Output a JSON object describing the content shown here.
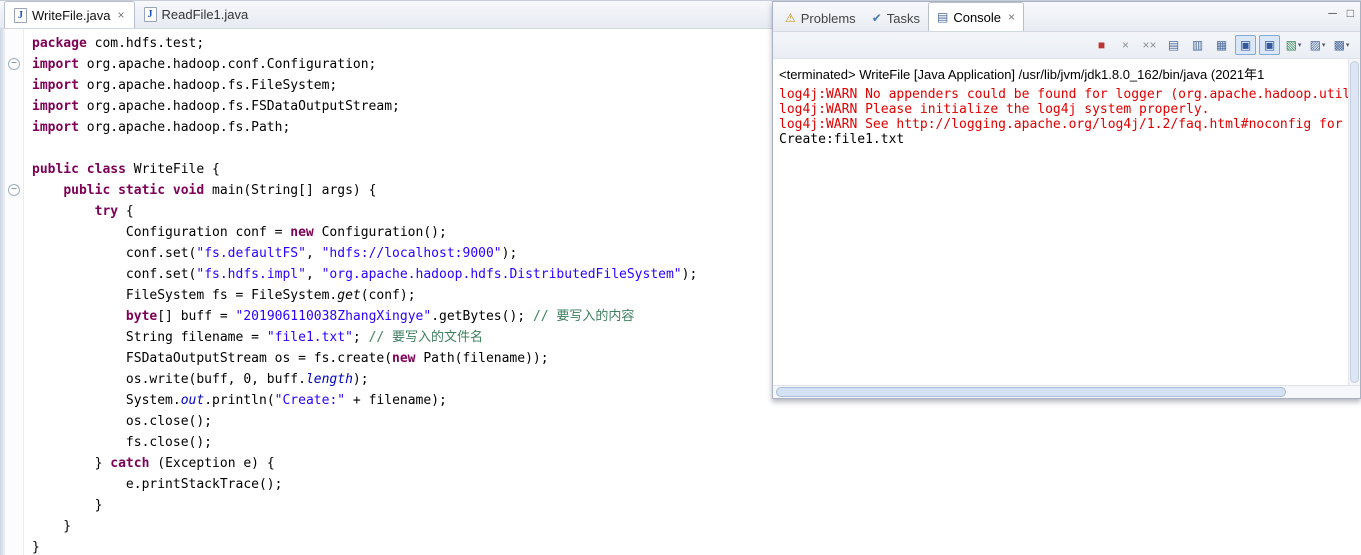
{
  "icons": {
    "java": "J",
    "close": "×",
    "problems": "⚠",
    "tasks": "✔",
    "console": "▤",
    "minimize": "─",
    "maximize": "□",
    "fold_collapse": "−",
    "dropdown": "▾"
  },
  "editor": {
    "tabs": [
      {
        "label": "WriteFile.java",
        "active": true
      },
      {
        "label": "ReadFile1.java",
        "active": false
      }
    ],
    "code": [
      [
        [
          "k",
          "package"
        ],
        [
          "p",
          " com.hdfs.test;"
        ]
      ],
      [
        [
          "k",
          "import"
        ],
        [
          "p",
          " org.apache.hadoop.conf.Configuration;"
        ]
      ],
      [
        [
          "k",
          "import"
        ],
        [
          "p",
          " org.apache.hadoop.fs.FileSystem;"
        ]
      ],
      [
        [
          "k",
          "import"
        ],
        [
          "p",
          " org.apache.hadoop.fs.FSDataOutputStream;"
        ]
      ],
      [
        [
          "k",
          "import"
        ],
        [
          "p",
          " org.apache.hadoop.fs.Path;"
        ]
      ],
      [],
      [
        [
          "k",
          "public"
        ],
        [
          "p",
          " "
        ],
        [
          "k",
          "class"
        ],
        [
          "p",
          " WriteFile {"
        ]
      ],
      [
        [
          "p",
          "    "
        ],
        [
          "k",
          "public"
        ],
        [
          "p",
          " "
        ],
        [
          "k",
          "static"
        ],
        [
          "p",
          " "
        ],
        [
          "k",
          "void"
        ],
        [
          "p",
          " main(String[] args) {"
        ]
      ],
      [
        [
          "p",
          "        "
        ],
        [
          "k",
          "try"
        ],
        [
          "p",
          " {"
        ]
      ],
      [
        [
          "p",
          "            Configuration conf = "
        ],
        [
          "k",
          "new"
        ],
        [
          "p",
          " Configuration();"
        ]
      ],
      [
        [
          "p",
          "            conf.set("
        ],
        [
          "s",
          "\"fs.defaultFS\""
        ],
        [
          "p",
          ", "
        ],
        [
          "s",
          "\"hdfs://localhost:9000\""
        ],
        [
          "p",
          ");"
        ]
      ],
      [
        [
          "p",
          "            conf.set("
        ],
        [
          "s",
          "\"fs.hdfs.impl\""
        ],
        [
          "p",
          ", "
        ],
        [
          "s",
          "\"org.apache.hadoop.hdfs.DistributedFileSystem\""
        ],
        [
          "p",
          ");"
        ]
      ],
      [
        [
          "p",
          "            FileSystem fs = FileSystem."
        ],
        [
          "m",
          "get"
        ],
        [
          "p",
          "(conf);"
        ]
      ],
      [
        [
          "p",
          "            "
        ],
        [
          "k",
          "byte"
        ],
        [
          "p",
          "[] buff = "
        ],
        [
          "s",
          "\"201906110038ZhangXingye\""
        ],
        [
          "p",
          ".getBytes(); "
        ],
        [
          "c",
          "// 要写入的内容"
        ]
      ],
      [
        [
          "p",
          "            String filename = "
        ],
        [
          "s",
          "\"file1.txt\""
        ],
        [
          "p",
          "; "
        ],
        [
          "c",
          "// 要写入的文件名"
        ]
      ],
      [
        [
          "p",
          "            FSDataOutputStream os = fs.create("
        ],
        [
          "k",
          "new"
        ],
        [
          "p",
          " Path(filename));"
        ]
      ],
      [
        [
          "p",
          "            os.write(buff, 0, buff."
        ],
        [
          "f",
          "length"
        ],
        [
          "p",
          ");"
        ]
      ],
      [
        [
          "p",
          "            System."
        ],
        [
          "f",
          "out"
        ],
        [
          "p",
          ".println("
        ],
        [
          "s",
          "\"Create:\""
        ],
        [
          "p",
          " + filename);"
        ]
      ],
      [
        [
          "p",
          "            os.close();"
        ]
      ],
      [
        [
          "p",
          "            fs.close();"
        ]
      ],
      [
        [
          "p",
          "        } "
        ],
        [
          "k",
          "catch"
        ],
        [
          "p",
          " (Exception e) {"
        ]
      ],
      [
        [
          "p",
          "            e.printStackTrace();"
        ]
      ],
      [
        [
          "p",
          "        }"
        ]
      ],
      [
        [
          "p",
          "    }"
        ]
      ],
      [
        [
          "p",
          "}"
        ]
      ]
    ]
  },
  "console": {
    "tabs": [
      {
        "label": "Problems",
        "active": false
      },
      {
        "label": "Tasks",
        "active": false
      },
      {
        "label": "Console",
        "active": true
      }
    ],
    "status_line": "<terminated> WriteFile [Java Application] /usr/lib/jvm/jdk1.8.0_162/bin/java (2021年1",
    "toolbar": [
      {
        "name": "terminate-button",
        "glyph": "■",
        "color": "#bc3434"
      },
      {
        "name": "remove-launch-button",
        "glyph": "×",
        "color": "#8a8f98"
      },
      {
        "name": "remove-all-terminated-button",
        "glyph": "××",
        "color": "#8a8f98"
      },
      {
        "name": "clear-console-button",
        "glyph": "▤",
        "color": "#4a6a9a"
      },
      {
        "name": "scroll-lock-button",
        "glyph": "▥",
        "color": "#4a6a9a"
      },
      {
        "name": "word-wrap-button",
        "glyph": "▦",
        "color": "#4a6a9a"
      },
      {
        "name": "show-stdout-button",
        "glyph": "▣",
        "color": "#36599c",
        "pressed": true
      },
      {
        "name": "activate-on-output-button",
        "glyph": "▣",
        "color": "#36599c",
        "pressed": true
      },
      {
        "name": "open-console-button",
        "glyph": "▧",
        "color": "#3a8a5a",
        "dropdown": true
      },
      {
        "name": "display-console-button",
        "glyph": "▨",
        "color": "#4a6a9a",
        "dropdown": true
      },
      {
        "name": "pin-console-button",
        "glyph": "▩",
        "color": "#4a6a9a",
        "dropdown": true
      }
    ],
    "output": [
      {
        "text": "log4j:WARN No appenders could be found for logger (org.apache.hadoop.util",
        "type": "stderr"
      },
      {
        "text": "log4j:WARN Please initialize the log4j system properly.",
        "type": "stderr"
      },
      {
        "text": "log4j:WARN See http://logging.apache.org/log4j/1.2/faq.html#noconfig for ",
        "type": "stderr"
      },
      {
        "text": "Create:file1.txt",
        "type": "stdout"
      }
    ]
  }
}
